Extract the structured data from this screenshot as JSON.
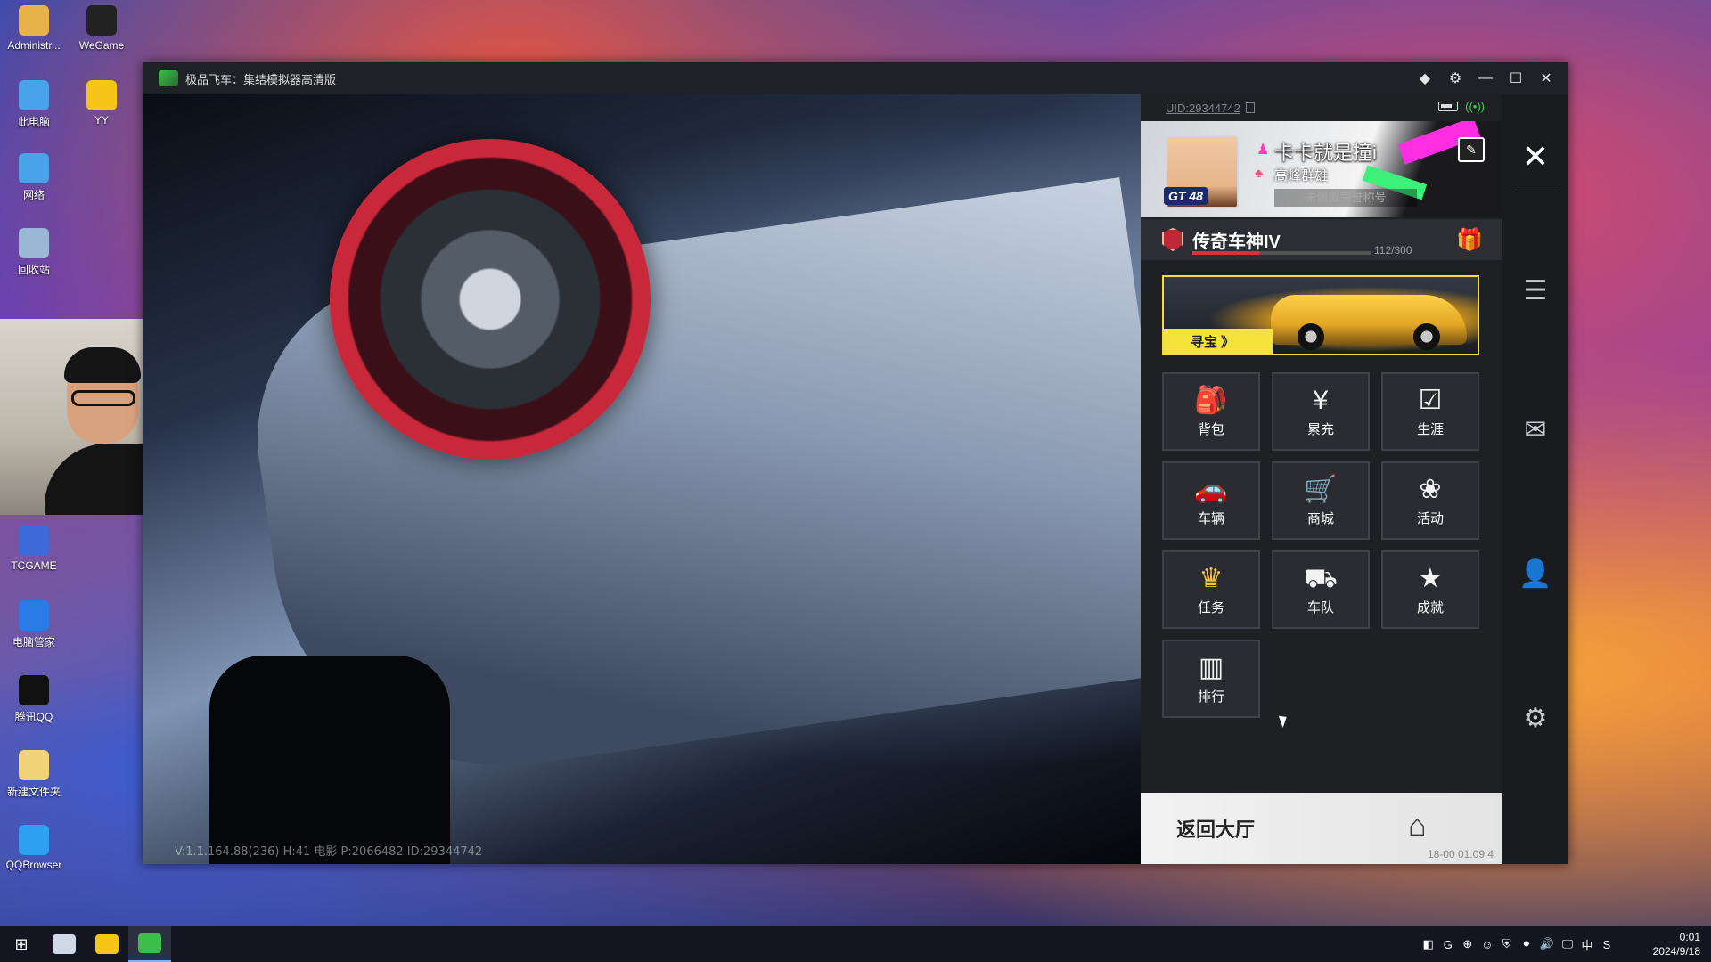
{
  "desktop": {
    "icons": [
      {
        "label": "Administr...",
        "icon": "user-folder-icon",
        "color": "#e8b24a"
      },
      {
        "label": "WeGame",
        "icon": "wegame-icon",
        "color": "#222222"
      },
      {
        "label": "此电脑",
        "icon": "computer-icon",
        "color": "#4aa3e8"
      },
      {
        "label": "YY",
        "icon": "yy-icon",
        "color": "#f5c518"
      },
      {
        "label": "网络",
        "icon": "network-icon",
        "color": "#4aa3e8"
      },
      {
        "label": "回收站",
        "icon": "recycle-bin-icon",
        "color": "#9ab7d6"
      },
      {
        "label": "TCGAME",
        "icon": "tcgame-icon",
        "color": "#3c6ad8"
      },
      {
        "label": "电脑管家",
        "icon": "pc-manager-icon",
        "color": "#2a7be8"
      },
      {
        "label": "腾讯QQ",
        "icon": "qq-icon",
        "color": "#111111"
      },
      {
        "label": "新建文件夹",
        "icon": "folder-icon",
        "color": "#f1d37a"
      },
      {
        "label": "QQBrowser",
        "icon": "qqbrowser-icon",
        "color": "#2ea0f0"
      }
    ]
  },
  "window": {
    "title": "极品飞车：集结模拟器高清版",
    "controls": {
      "gem": "◆",
      "settings": "⚙",
      "minimize": "—",
      "maximize": "☐",
      "close": "✕"
    }
  },
  "scene": {
    "debug_text": "V:1.1.164.88(236) H:41 电影 P:2066482 ID:29344742"
  },
  "panel": {
    "uid": "UID:29344742",
    "profile": {
      "name": "卡卡就是撞i",
      "guild": "高峰群雄",
      "title_slot": "未佩戴荣誉称号",
      "level": "GT 48"
    },
    "rank": {
      "name": "传奇车神IV",
      "progress_text": "112/300",
      "progress_current": 112,
      "progress_max": 300
    },
    "banner": {
      "label": "寻宝 》"
    },
    "tiles": [
      {
        "label": "背包",
        "icon": "backpack-icon",
        "glyph": "🎒"
      },
      {
        "label": "累充",
        "icon": "recharge-icon",
        "glyph": "¥"
      },
      {
        "label": "生涯",
        "icon": "career-icon",
        "glyph": "☑"
      },
      {
        "label": "车辆",
        "icon": "car-icon",
        "glyph": "🚗"
      },
      {
        "label": "商城",
        "icon": "shop-cart-icon",
        "glyph": "🛒"
      },
      {
        "label": "活动",
        "icon": "event-icon",
        "glyph": "❀"
      },
      {
        "label": "任务",
        "icon": "task-crown-icon",
        "glyph": "♛"
      },
      {
        "label": "车队",
        "icon": "team-icon",
        "glyph": "⛟"
      },
      {
        "label": "成就",
        "icon": "achievement-icon",
        "glyph": "★"
      },
      {
        "label": "排行",
        "icon": "ranking-icon",
        "glyph": "▥"
      }
    ],
    "home": {
      "label": "返回大厅",
      "clock": "18-00 01.09.4"
    }
  },
  "rail": {
    "close": "✕",
    "switch": "☰",
    "mail": "✉",
    "friend": "👤",
    "settings": "⚙"
  },
  "taskbar": {
    "start": "⊞",
    "tray": [
      "◧",
      "G",
      "⊕",
      "☺",
      "⛨",
      "⚫",
      "🔊",
      "🖵",
      "中",
      "S"
    ],
    "time": "0:01",
    "date": "2024/9/18"
  }
}
